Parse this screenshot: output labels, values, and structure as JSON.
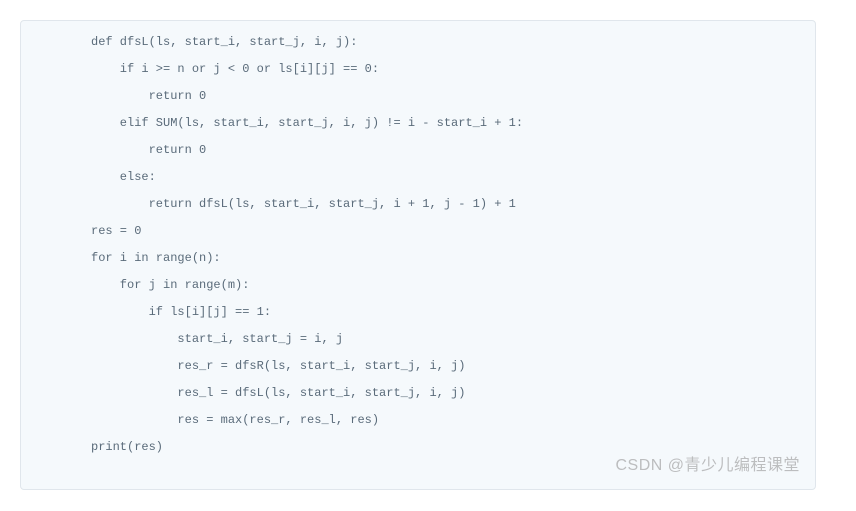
{
  "code": {
    "lines": [
      "def dfsL(ls, start_i, start_j, i, j):",
      "    if i >= n or j < 0 or ls[i][j] == 0:",
      "        return 0",
      "    elif SUM(ls, start_i, start_j, i, j) != i - start_i + 1:",
      "        return 0",
      "    else:",
      "        return dfsL(ls, start_i, start_j, i + 1, j - 1) + 1",
      "",
      "res = 0",
      "for i in range(n):",
      "    for j in range(m):",
      "        if ls[i][j] == 1:",
      "            start_i, start_j = i, j",
      "            res_r = dfsR(ls, start_i, start_j, i, j)",
      "            res_l = dfsL(ls, start_i, start_j, i, j)",
      "            res = max(res_r, res_l, res)",
      "print(res)"
    ]
  },
  "watermark": "CSDN @青少儿编程课堂"
}
